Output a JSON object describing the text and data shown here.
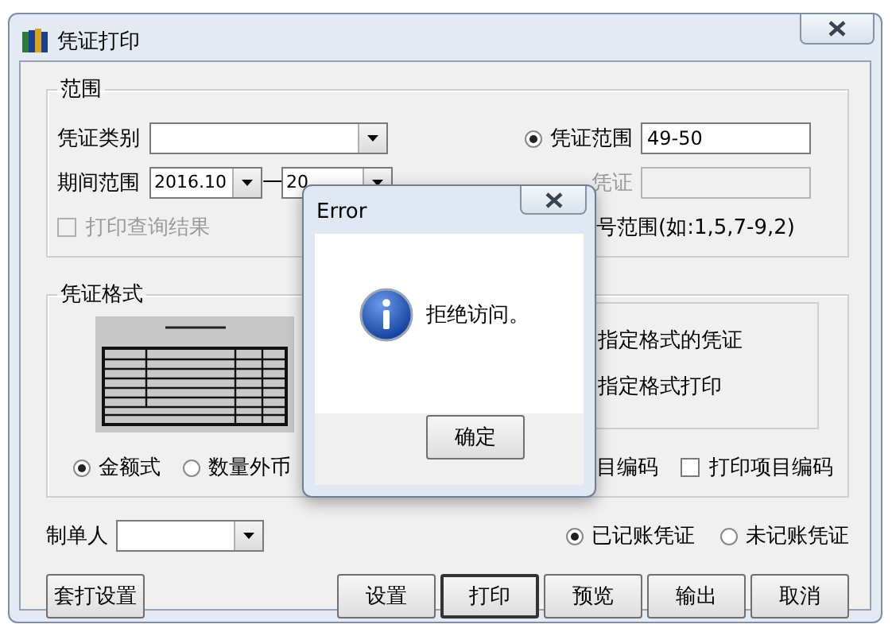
{
  "window": {
    "title": "凭证打印"
  },
  "range_group": {
    "title": "范围",
    "voucher_type": {
      "label": "凭证类别"
    },
    "period": {
      "label": "期间范围",
      "from": "2016.10",
      "separator": "一",
      "to": "20"
    },
    "voucher_range": {
      "label": "凭证范围",
      "selected": true,
      "value": "49-50"
    },
    "voucher_option": {
      "label": "凭证",
      "disabled": true
    },
    "print_query": {
      "label": "打印查询结果",
      "checked": false,
      "disabled": true
    },
    "number_hint": "号范围(如:1,5,7-9,2)"
  },
  "format_group": {
    "title": "凭证格式",
    "format_options": [
      {
        "label": "指定格式的凭证"
      },
      {
        "label": "指定格式打印"
      }
    ],
    "styles": [
      {
        "label": "金额式",
        "selected": true
      },
      {
        "label": "数量外币",
        "selected": false
      }
    ],
    "subject_code": "目编码",
    "print_item_code": {
      "label": "打印项目编码",
      "checked": false
    }
  },
  "maker": {
    "label": "制单人"
  },
  "posting": [
    {
      "label": "已记账凭证",
      "selected": true
    },
    {
      "label": "未记账凭证",
      "selected": false
    }
  ],
  "buttons": [
    {
      "label": "套打设置",
      "default": false
    },
    {
      "label": "设置",
      "default": false
    },
    {
      "label": "打印",
      "default": true
    },
    {
      "label": "预览",
      "default": false
    },
    {
      "label": "输出",
      "default": false
    },
    {
      "label": "取消",
      "default": false
    }
  ],
  "dialog": {
    "title": "Error",
    "message": "拒绝访问。",
    "button": "确定"
  }
}
